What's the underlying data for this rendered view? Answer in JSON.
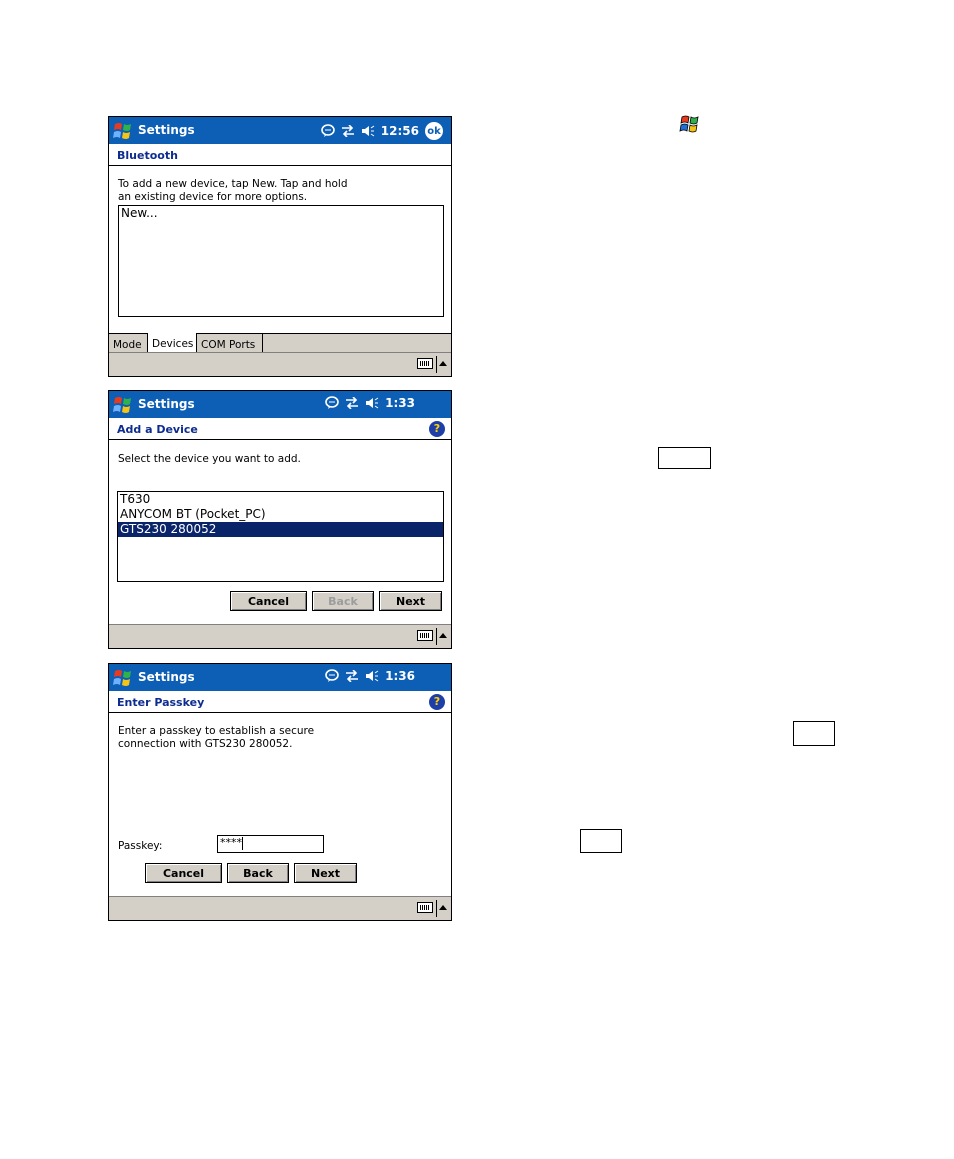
{
  "screen1": {
    "title": "Settings",
    "time": "12:56",
    "ok_label": "ok",
    "header": "Bluetooth",
    "instructions": [
      "To add a new device, tap New. Tap and hold",
      "an existing device for more options."
    ],
    "list_items": [
      "New..."
    ],
    "tabs": [
      "Mode",
      "Devices",
      "COM Ports"
    ],
    "active_tab": "Devices"
  },
  "screen2": {
    "title": "Settings",
    "time": "1:33",
    "header": "Add a Device",
    "help_label": "?",
    "instructions": "Select the device you want to add.",
    "devices": [
      "T630",
      "ANYCOM BT (Pocket_PC)",
      "GTS230 280052"
    ],
    "selected_device": "GTS230 280052",
    "buttons": {
      "cancel": "Cancel",
      "back": "Back",
      "next": "Next"
    }
  },
  "screen3": {
    "title": "Settings",
    "time": "1:36",
    "header": "Enter Passkey",
    "help_label": "?",
    "instructions": [
      "Enter a passkey to establish a secure",
      "connection with GTS230 280052."
    ],
    "passkey_label": "Passkey:",
    "passkey_value": "****",
    "buttons": {
      "cancel": "Cancel",
      "back": "Back",
      "next": "Next"
    }
  },
  "colors": {
    "title_bar": "#0c5fb4",
    "header_text": "#0d2c8f",
    "selection": "#0a246a",
    "button_face": "#d4d0c8"
  },
  "icons": [
    "windows-flag-icon",
    "speech-bubble-icon",
    "connectivity-arrows-icon",
    "speaker-icon",
    "keyboard-icon",
    "help-icon"
  ]
}
